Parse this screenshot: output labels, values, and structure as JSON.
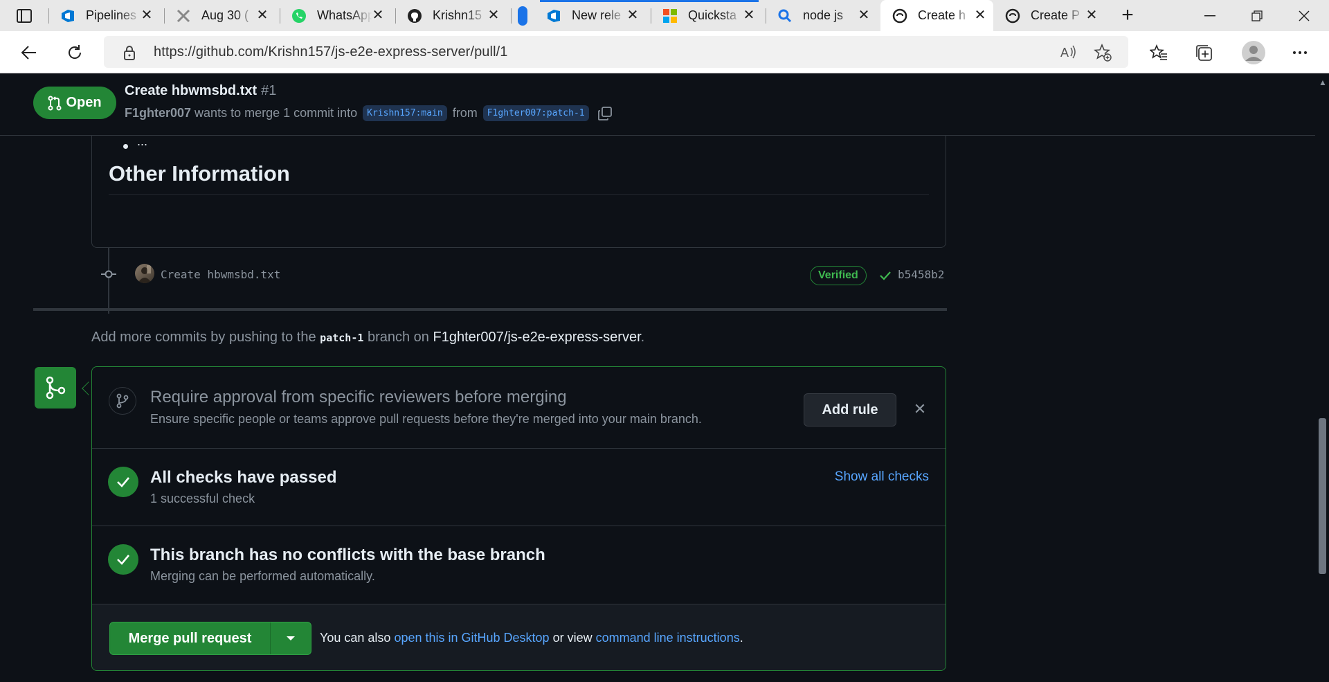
{
  "browser": {
    "tabs": [
      {
        "label": "Pipelines",
        "icon": "azure-devops-icon",
        "active": false
      },
      {
        "label": "Aug 30 (",
        "icon": "tools-icon",
        "active": false
      },
      {
        "label": "WhatsApp",
        "icon": "whatsapp-icon",
        "active": false
      },
      {
        "label": "Krishn15",
        "icon": "github-icon",
        "active": false
      },
      {
        "label": "New rele",
        "icon": "azure-devops-icon",
        "active": false
      },
      {
        "label": "Quicksta",
        "icon": "microsoft-icon",
        "active": false
      },
      {
        "label": "node js",
        "icon": "search-icon",
        "active": false
      },
      {
        "label": "Create h",
        "icon": "github-icon",
        "active": true
      },
      {
        "label": "Create P",
        "icon": "github-icon",
        "active": false
      }
    ],
    "url": "https://github.com/Krishn157/js-e2e-express-server/pull/1"
  },
  "pr": {
    "status": "Open",
    "title": "Create hbwmsbd.txt",
    "number": "#1",
    "author": "F1ghter007",
    "merge_text": "wants to merge 1 commit into",
    "base_branch": "Krishn157:main",
    "from_text": "from",
    "head_branch": "F1ghter007:patch-1"
  },
  "description": {
    "bullet": "...",
    "heading": "Other Information"
  },
  "commit": {
    "message": "Create hbwmsbd.txt",
    "verified": "Verified",
    "sha": "b5458b2"
  },
  "push_note": {
    "pre": "Add more commits by pushing to the",
    "branch": "patch-1",
    "mid": "branch on",
    "repo": "F1ghter007/js-e2e-express-server",
    "post": "."
  },
  "merge_box": {
    "rule_title": "Require approval from specific reviewers before merging",
    "rule_sub": "Ensure specific people or teams approve pull requests before they're merged into your main branch.",
    "add_rule": "Add rule",
    "checks_title": "All checks have passed",
    "checks_sub": "1 successful check",
    "show_checks": "Show all checks",
    "conflict_title": "This branch has no conflicts with the base branch",
    "conflict_sub": "Merging can be performed automatically.",
    "merge_button": "Merge pull request",
    "also_text": "You can also",
    "desktop_link": "open this in GitHub Desktop",
    "or_view": "or view",
    "cli_link": "command line instructions",
    "end": "."
  },
  "colors": {
    "bg": "#0d1117",
    "green": "#238636",
    "link": "#58a6ff",
    "muted": "#8b949e"
  }
}
